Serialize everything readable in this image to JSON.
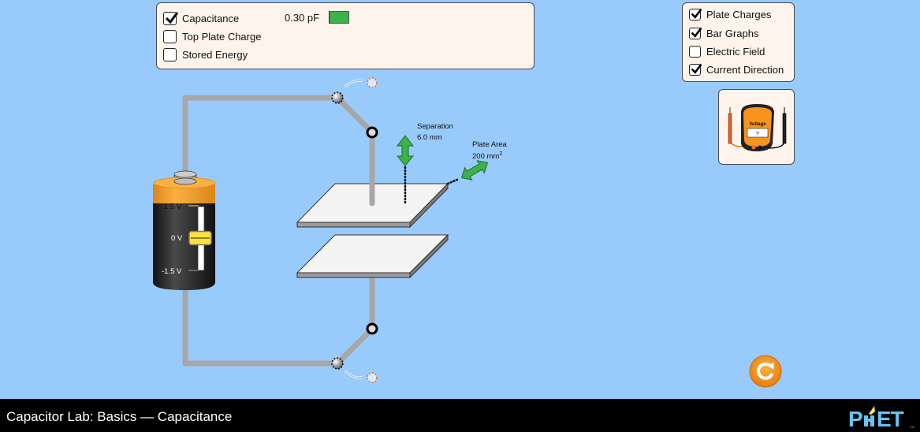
{
  "measure_panel": {
    "items": [
      {
        "label": "Capacitance",
        "checked": true
      },
      {
        "label": "Top Plate Charge",
        "checked": false
      },
      {
        "label": "Stored Energy",
        "checked": false
      }
    ],
    "capacitance_value": "0.30 pF",
    "bar_color": "#3cb34a"
  },
  "view_panel": {
    "items": [
      {
        "label": "Plate Charges",
        "checked": true
      },
      {
        "label": "Bar Graphs",
        "checked": true
      },
      {
        "label": "Electric Field",
        "checked": false
      },
      {
        "label": "Current Direction",
        "checked": true
      }
    ]
  },
  "voltmeter": {
    "label": "Voltage",
    "reading": "?"
  },
  "battery": {
    "tick_max": "1.5 V",
    "tick_mid": "0 V",
    "tick_min": "-1.5 V",
    "voltage_fraction": 0.5
  },
  "capacitor": {
    "separation_label": "Separation",
    "separation_value": "6.0 mm",
    "area_label": "Plate Area",
    "area_value": "200 mm",
    "area_unit_exp": "2"
  },
  "footer": {
    "title": "Capacitor Lab: Basics — Capacitance",
    "logo": "PhET"
  },
  "colors": {
    "background": "#98cbfc",
    "panel": "#fef4ec",
    "accent_orange": "#f7941d",
    "arrow_green": "#3cb34a"
  }
}
